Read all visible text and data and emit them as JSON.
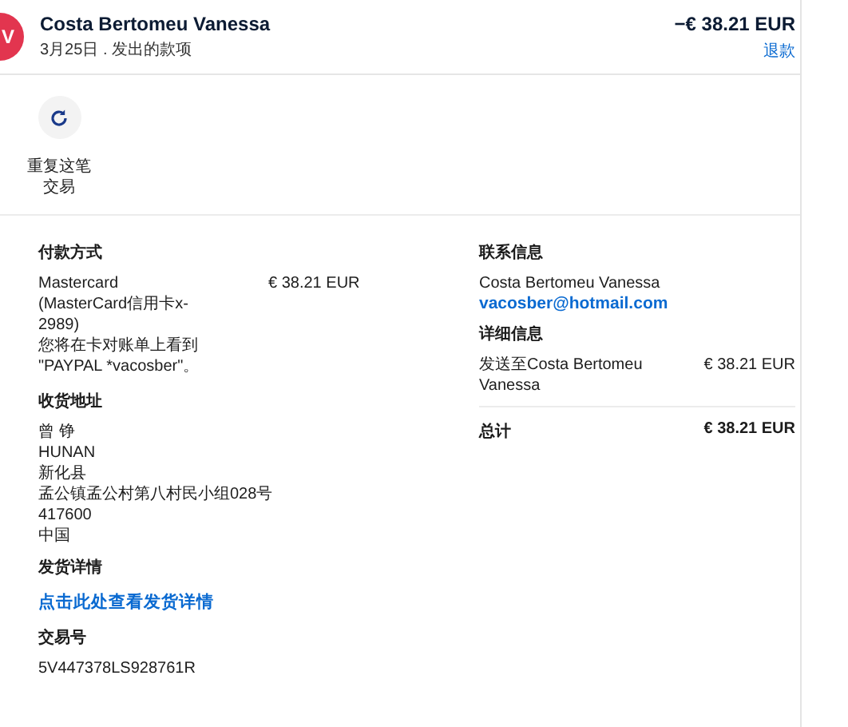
{
  "header": {
    "avatar": "V",
    "name": "Costa Bertomeu Vanessa",
    "subtitle": "3月25日 . 发出的款项",
    "amount": "−€ 38.21 EUR",
    "action": "退款"
  },
  "actions": [
    {
      "label": "重复这笔交易"
    }
  ],
  "payment": {
    "title": "付款方式",
    "method": [
      "Mastercard",
      "(MasterCard信用卡x-",
      "2989)",
      "您将在卡对账单上看到",
      "\"PAYPAL *vacosber\"。"
    ],
    "amount": "€ 38.21 EUR"
  },
  "shipping_address": {
    "title": "收货地址",
    "lines": [
      "曾 铮",
      "HUNAN",
      "新化县",
      "孟公镇孟公村第八村民小组028号",
      "417600",
      "中国"
    ]
  },
  "shipping_details": {
    "title": "发货详情",
    "link": "点击此处查看发货详情"
  },
  "transaction": {
    "title": "交易号",
    "id": "5V447378LS928761R"
  },
  "contact": {
    "title": "联系信息",
    "name": "Costa Bertomeu Vanessa",
    "email": "vacosber@hotmail.com"
  },
  "details": {
    "title": "详细信息",
    "item": "发送至Costa Bertomeu Vanessa",
    "amount": "€ 38.21 EUR",
    "total_label": "总计",
    "total": "€ 38.21 EUR"
  }
}
